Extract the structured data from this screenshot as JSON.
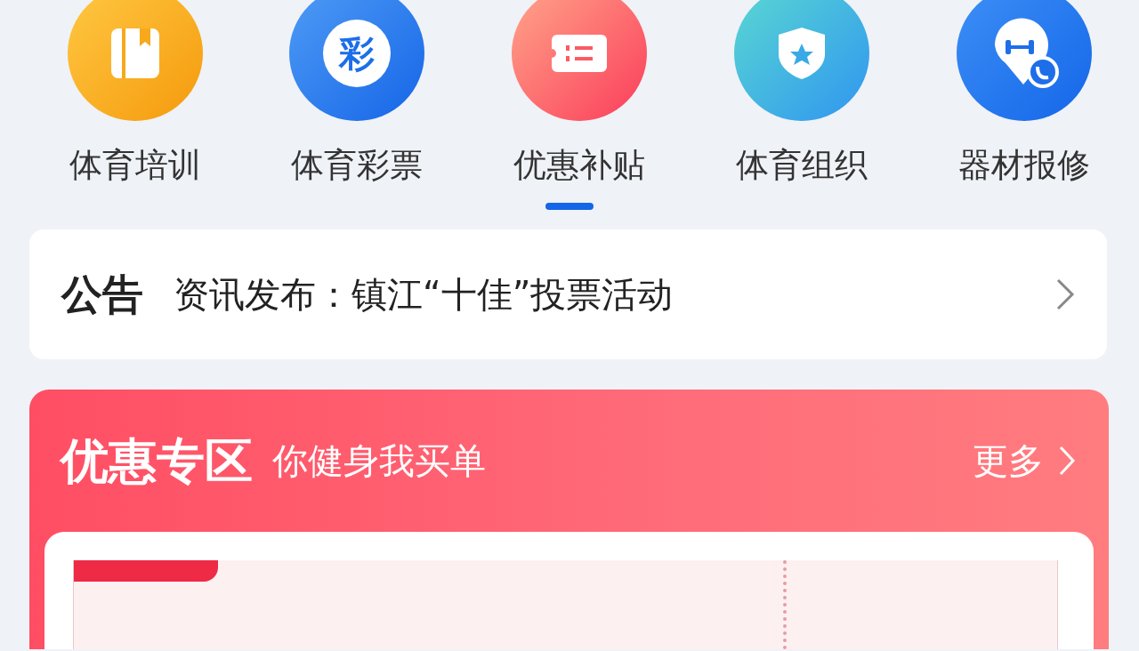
{
  "shortcuts": [
    {
      "label": "体育培训",
      "kind": "book"
    },
    {
      "label": "体育彩票",
      "kind": "lottery",
      "glyph": "彩"
    },
    {
      "label": "优惠补贴",
      "kind": "ticket"
    },
    {
      "label": "体育组织",
      "kind": "shield"
    },
    {
      "label": "器材报修",
      "kind": "repair"
    }
  ],
  "notice": {
    "badge": "公告",
    "text": "资讯发布：镇江“十佳”投票活动"
  },
  "promo": {
    "title": "优惠专区",
    "subtitle": "你健身我买单",
    "more": "更多"
  }
}
